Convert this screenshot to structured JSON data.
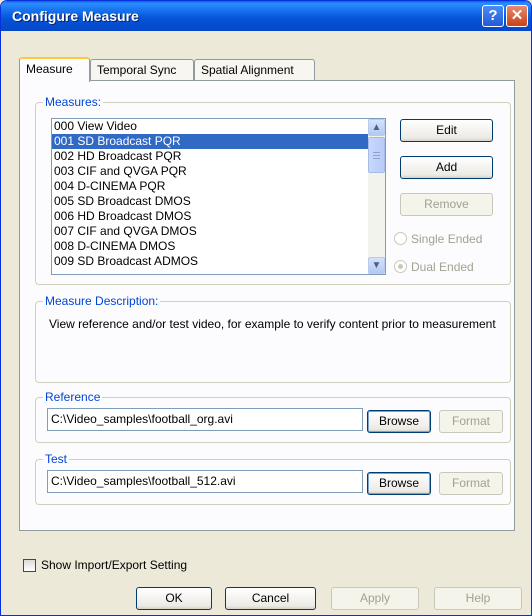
{
  "window": {
    "title": "Configure Measure",
    "help_glyph": "?",
    "close_glyph": "✕"
  },
  "tabs": [
    {
      "label": "Measure",
      "active": true
    },
    {
      "label": "Temporal Sync",
      "active": false
    },
    {
      "label": "Spatial Alignment",
      "active": false
    }
  ],
  "measures": {
    "legend": "Measures:",
    "items": [
      "000 View Video",
      "001 SD Broadcast PQR",
      "002 HD Broadcast PQR",
      "003 CIF and QVGA PQR",
      "004 D-CINEMA PQR",
      "005 SD Broadcast DMOS",
      "006 HD Broadcast DMOS",
      "007 CIF and QVGA DMOS",
      "008 D-CINEMA DMOS",
      "009 SD Broadcast ADMOS"
    ],
    "selected_index": 1,
    "buttons": {
      "edit": "Edit",
      "add": "Add",
      "remove": "Remove"
    },
    "radios": {
      "single": "Single Ended",
      "dual": "Dual Ended"
    },
    "scroll_up_glyph": "▲",
    "scroll_down_glyph": "▼"
  },
  "description": {
    "legend": "Measure Description:",
    "text": "View reference and/or test video, for example to verify content prior to measurement"
  },
  "reference": {
    "legend": "Reference",
    "path": "C:\\Video_samples\\football_org.avi",
    "browse": "Browse",
    "format": "Format"
  },
  "test": {
    "legend": "Test",
    "path": "C:\\Video_samples\\football_512.avi",
    "browse": "Browse",
    "format": "Format"
  },
  "footer": {
    "show_import_export": "Show Import/Export Setting",
    "ok": "OK",
    "cancel": "Cancel",
    "apply": "Apply",
    "help": "Help"
  },
  "colors": {
    "titlebar": "#0554d6",
    "selection": "#316ac5",
    "group_legend": "#0046d5",
    "disabled_text": "#a3a192"
  }
}
